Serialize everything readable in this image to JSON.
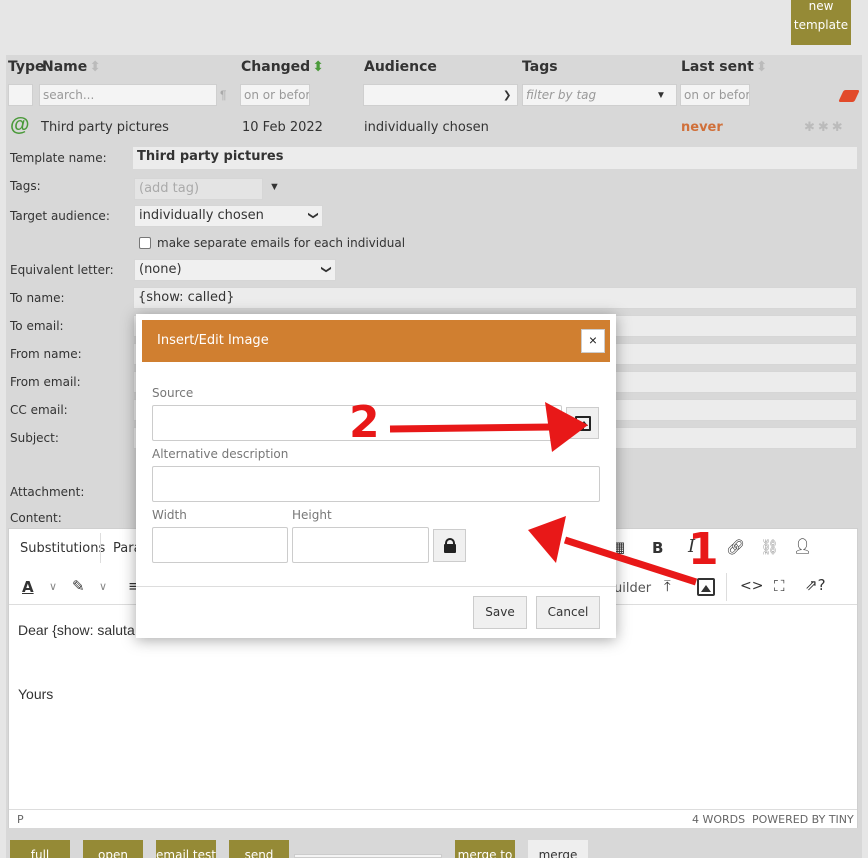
{
  "top_button": {
    "label_line1": "new",
    "label_line2": "template"
  },
  "table": {
    "headers": {
      "type": "Type",
      "name": "Name",
      "changed": "Changed",
      "audience": "Audience",
      "tags": "Tags",
      "last_sent": "Last sent"
    },
    "filters": {
      "name_placeholder": "search...",
      "changed_placeholder": "on or before.",
      "tags_placeholder": "filter by tag",
      "last_sent_placeholder": "on or before."
    },
    "row": {
      "name": "Third party pictures",
      "changed": "10 Feb 2022",
      "audience": "individually chosen",
      "last_sent": "never"
    }
  },
  "form": {
    "template_name_label": "Template name:",
    "template_name_value": "Third party pictures",
    "tags_label": "Tags:",
    "tags_placeholder": "(add tag)",
    "target_audience_label": "Target audience:",
    "target_audience_value": "individually chosen",
    "separate_emails_label": "make separate emails for each individual",
    "equivalent_letter_label": "Equivalent letter:",
    "equivalent_letter_value": "(none)",
    "to_name_label": "To name:",
    "to_name_value": "{show: called}",
    "to_email_label": "To email:",
    "from_name_label": "From name:",
    "from_email_label": "From email:",
    "cc_email_label": "CC email:",
    "subject_label": "Subject:",
    "attachment_label": "Attachment:",
    "content_label": "Content:"
  },
  "editor": {
    "tabs": {
      "substitutions": "Substitutions",
      "para": "Para"
    },
    "builder_text": "uilder",
    "body_line1": "Dear {show: saluta",
    "body_line2": "Yours",
    "status_path": "P",
    "status_words": "4 WORDS",
    "status_powered": "POWERED BY TINY"
  },
  "modal": {
    "title": "Insert/Edit Image",
    "close": "×",
    "source_label": "Source",
    "alt_label": "Alternative description",
    "width_label": "Width",
    "height_label": "Height",
    "save": "Save",
    "cancel": "Cancel"
  },
  "annotations": {
    "one": "1",
    "two": "2",
    "color": "#e81818"
  },
  "footer_buttons": [
    "full",
    "open",
    "email test",
    "send",
    "merge to",
    "merge"
  ],
  "colors": {
    "accent_olive": "#958a36",
    "modal_header": "#d07f30",
    "never": "#d0703a",
    "green": "#4a9a3a"
  }
}
